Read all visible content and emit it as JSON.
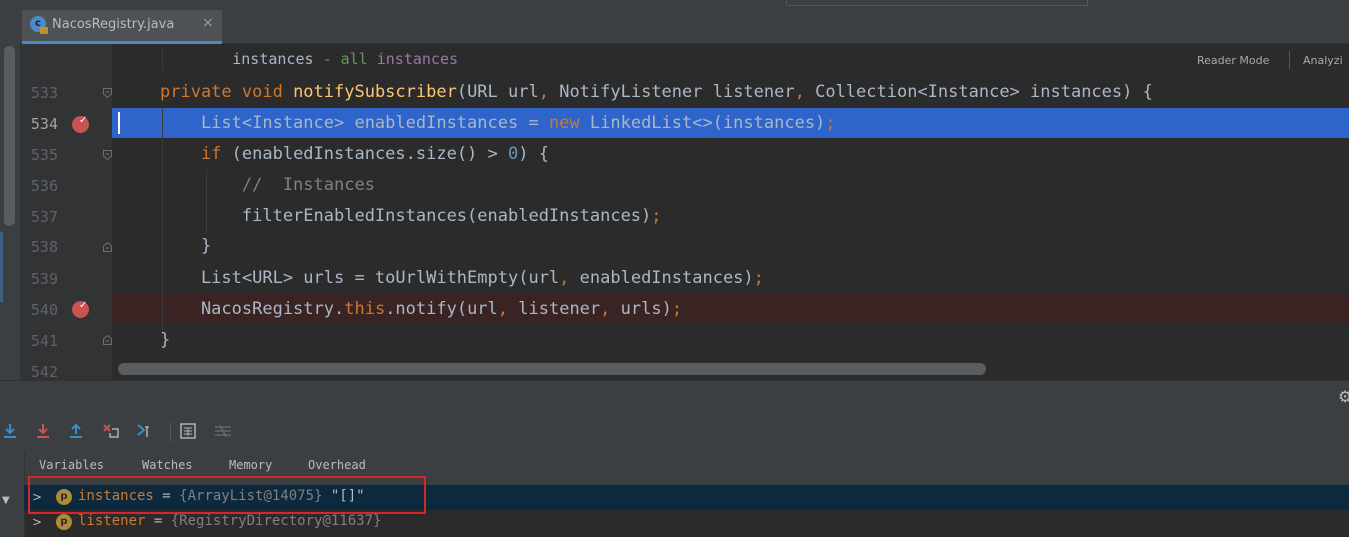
{
  "editor": {
    "tab_title": "NacosRegistry.java",
    "tab_close": "×",
    "tab_icon_letter": "c",
    "reader_mode": "Reader Mode",
    "analyze": "Analyzi",
    "lines": [
      {
        "num": "",
        "tokens": [
          [
            "",
            "        instances "
          ],
          [
            "doc",
            "- all "
          ],
          [
            "pur",
            "instances"
          ]
        ]
      },
      {
        "num": "533",
        "tokens": [
          [
            "kw",
            "private void "
          ],
          [
            "fn",
            "notifySubscriber"
          ],
          [
            "",
            "(URL url"
          ],
          [
            "kw",
            ", "
          ],
          [
            "",
            "NotifyListener listener"
          ],
          [
            "kw",
            ", "
          ],
          [
            "",
            "Collection<Instance> instances) {"
          ]
        ]
      },
      {
        "num": "534",
        "tokens": [
          [
            "",
            "    List<Instance> enabledInstances = "
          ],
          [
            "kw",
            "new "
          ],
          [
            "",
            "LinkedList<>(instances)"
          ],
          [
            "kw",
            ";"
          ]
        ]
      },
      {
        "num": "535",
        "tokens": [
          [
            "kw",
            "    if "
          ],
          [
            "",
            "(enabledInstances.size() > "
          ],
          [
            "num",
            "0"
          ],
          [
            "",
            ") {"
          ]
        ]
      },
      {
        "num": "536",
        "tokens": [
          [
            "cm",
            "        //  Instances"
          ]
        ]
      },
      {
        "num": "537",
        "tokens": [
          [
            "",
            "        filterEnabledInstances(enabledInstances)"
          ],
          [
            "kw",
            ";"
          ]
        ]
      },
      {
        "num": "538",
        "tokens": [
          [
            "",
            "    }"
          ]
        ]
      },
      {
        "num": "539",
        "tokens": [
          [
            "",
            "    List<URL> urls = toUrlWithEmpty(url"
          ],
          [
            "kw",
            ", "
          ],
          [
            "",
            "enabledInstances)"
          ],
          [
            "kw",
            ";"
          ]
        ]
      },
      {
        "num": "540",
        "tokens": [
          [
            "",
            "    NacosRegistry."
          ],
          [
            "kw",
            "this"
          ],
          [
            "",
            ".notify(url"
          ],
          [
            "kw",
            ", "
          ],
          [
            "",
            "listener"
          ],
          [
            "kw",
            ", "
          ],
          [
            "",
            "urls)"
          ],
          [
            "kw",
            ";"
          ]
        ]
      },
      {
        "num": "541",
        "tokens": [
          [
            "",
            "}"
          ]
        ]
      },
      {
        "num": "542",
        "tokens": [
          [
            "",
            ""
          ]
        ]
      }
    ]
  },
  "debugger": {
    "tabs": [
      "Variables",
      "Watches",
      "Memory",
      "Overhead"
    ],
    "variables": [
      {
        "name": "instances",
        "eq": " = ",
        "type": "{ArrayList@14075} ",
        "value": "\"[]\"",
        "badge": "p"
      },
      {
        "name": "listener",
        "eq": " = ",
        "type": "{RegistryDirectory@11637}",
        "value": "",
        "badge": "p"
      }
    ]
  },
  "colors": {
    "current_line": "#2f65ca",
    "breakpoint_line": "#3a2323",
    "breakpoint": "#c75450",
    "accent": "#4a88c7"
  }
}
